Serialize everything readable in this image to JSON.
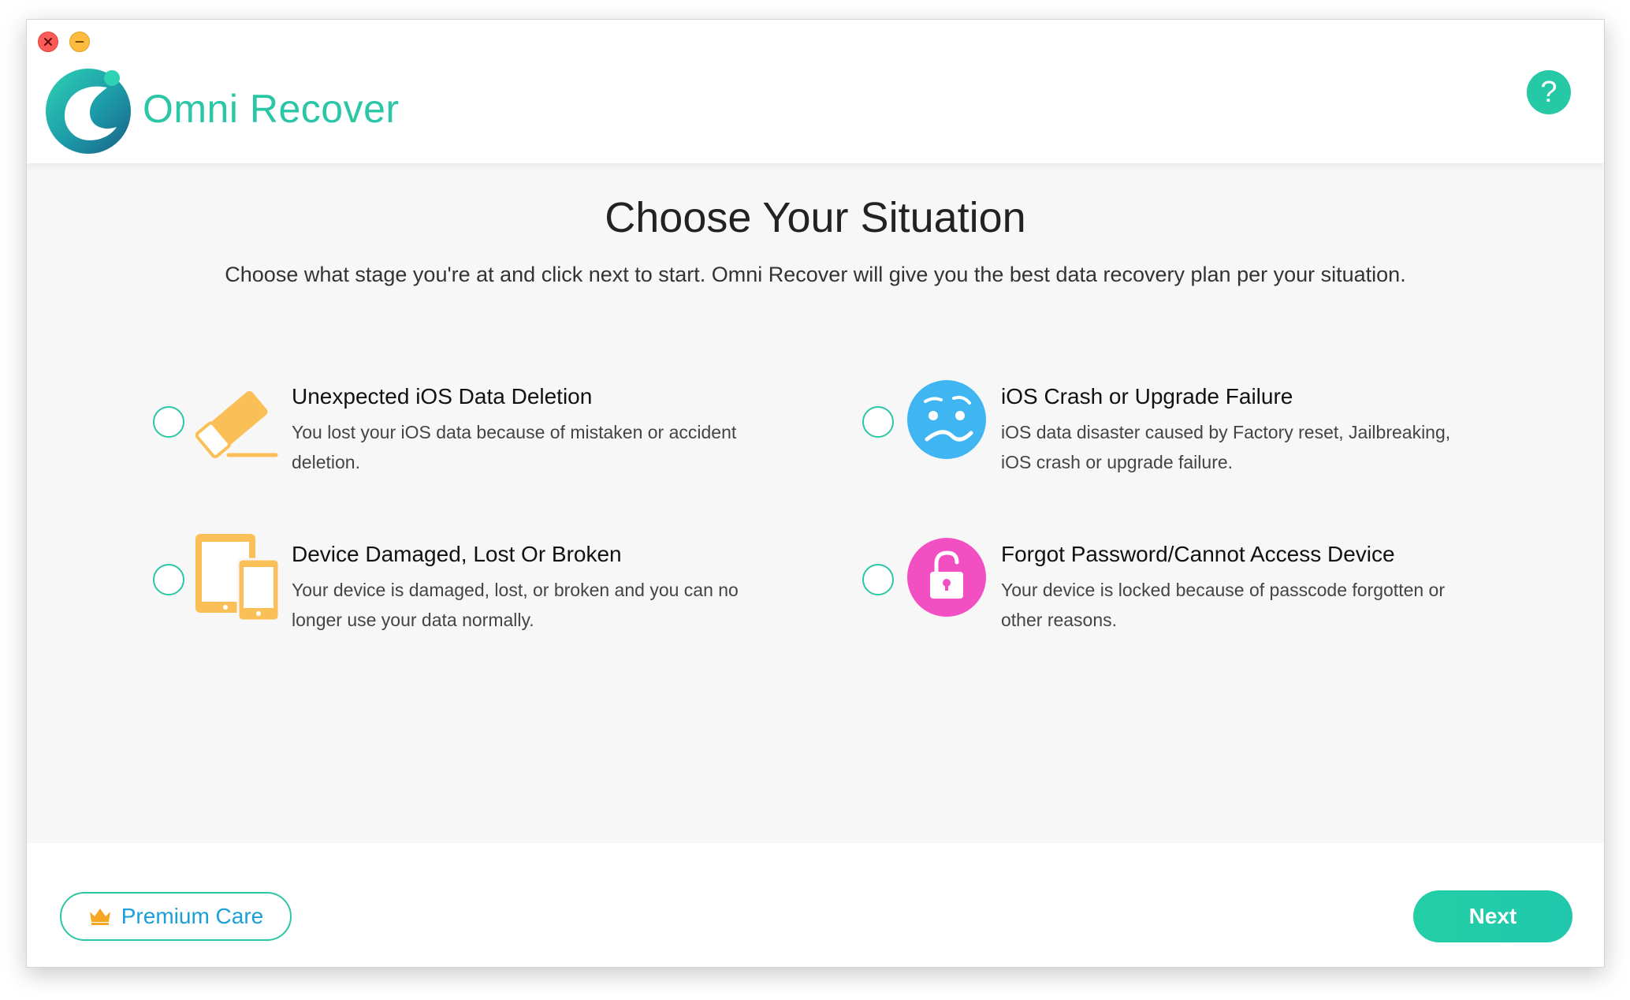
{
  "app": {
    "title": "Omni Recover",
    "logo_icon": "omni-recover-logo-icon",
    "help_label": "?"
  },
  "window_controls": {
    "close_icon": "close-icon",
    "minimize_icon": "minimize-icon"
  },
  "main": {
    "title": "Choose Your Situation",
    "subtitle": "Choose what stage you're at and click next to start. Omni Recover will give you the best data recovery plan per your situation."
  },
  "options": [
    {
      "id": "deletion",
      "icon": "eraser-icon",
      "title": "Unexpected iOS Data Deletion",
      "description": "You lost your iOS data because of mistaken or accident deletion.",
      "selected": false
    },
    {
      "id": "crash",
      "icon": "confused-face-icon",
      "title": "iOS Crash or Upgrade Failure",
      "description": "iOS data disaster caused by Factory reset, Jailbreaking, iOS crash or upgrade failure.",
      "selected": false
    },
    {
      "id": "damaged",
      "icon": "devices-icon",
      "title": "Device Damaged, Lost Or Broken",
      "description": "Your device is damaged, lost, or broken and you can no longer use your data normally.",
      "selected": false
    },
    {
      "id": "password",
      "icon": "unlock-icon",
      "title": "Forgot Password/Cannot Access Device",
      "description": "Your device is locked because of passcode forgotten or other reasons.",
      "selected": false
    }
  ],
  "footer": {
    "premium_label": "Premium Care",
    "premium_icon": "crown-icon",
    "next_label": "Next"
  },
  "colors": {
    "accent": "#2bc6a6",
    "premium_text": "#1a9fd9",
    "eraser": "#fbbf57",
    "face": "#3fb6f2",
    "devices": "#fbbf57",
    "lock": "#f24fc3"
  }
}
